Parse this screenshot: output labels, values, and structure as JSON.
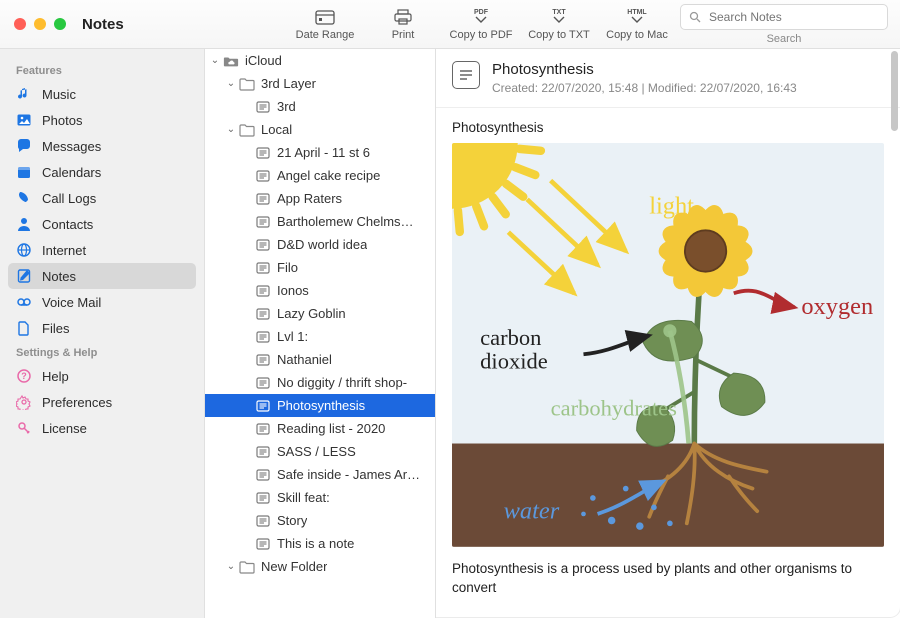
{
  "window": {
    "title": "Notes"
  },
  "toolbar": {
    "buttons": [
      {
        "id": "date-range",
        "label": "Date Range"
      },
      {
        "id": "print",
        "label": "Print"
      },
      {
        "id": "copy-pdf",
        "label": "Copy to PDF",
        "badge": "PDF"
      },
      {
        "id": "copy-txt",
        "label": "Copy to TXT",
        "badge": "TXT"
      },
      {
        "id": "copy-mac",
        "label": "Copy to Mac",
        "badge": "HTML"
      }
    ],
    "search": {
      "placeholder": "Search Notes",
      "label": "Search"
    }
  },
  "sidebar": {
    "sections": [
      {
        "label": "Features",
        "items": [
          {
            "id": "music",
            "label": "Music",
            "color": "#1e76e3",
            "icon": "music"
          },
          {
            "id": "photos",
            "label": "Photos",
            "color": "#1e76e3",
            "icon": "photo"
          },
          {
            "id": "messages",
            "label": "Messages",
            "color": "#1e76e3",
            "icon": "chat"
          },
          {
            "id": "calendars",
            "label": "Calendars",
            "color": "#1e76e3",
            "icon": "calendar"
          },
          {
            "id": "calllogs",
            "label": "Call Logs",
            "color": "#1e76e3",
            "icon": "phone"
          },
          {
            "id": "contacts",
            "label": "Contacts",
            "color": "#1e76e3",
            "icon": "person"
          },
          {
            "id": "internet",
            "label": "Internet",
            "color": "#1e76e3",
            "icon": "globe"
          },
          {
            "id": "notes",
            "label": "Notes",
            "color": "#1e76e3",
            "icon": "note",
            "selected": true
          },
          {
            "id": "voicemail",
            "label": "Voice Mail",
            "color": "#1e76e3",
            "icon": "voicemail"
          },
          {
            "id": "files",
            "label": "Files",
            "color": "#1e76e3",
            "icon": "file"
          }
        ]
      },
      {
        "label": "Settings & Help",
        "items": [
          {
            "id": "help",
            "label": "Help",
            "color": "#e96aa9",
            "icon": "help"
          },
          {
            "id": "preferences",
            "label": "Preferences",
            "color": "#e96aa9",
            "icon": "prefs"
          },
          {
            "id": "license",
            "label": "License",
            "color": "#e96aa9",
            "icon": "license"
          }
        ]
      }
    ]
  },
  "tree": {
    "nodes": [
      {
        "depth": 0,
        "type": "folder",
        "label": "iCloud",
        "open": true,
        "icon": "cloud"
      },
      {
        "depth": 1,
        "type": "folder",
        "label": "3rd Layer",
        "open": true
      },
      {
        "depth": 2,
        "type": "note",
        "label": "3rd"
      },
      {
        "depth": 1,
        "type": "folder",
        "label": "Local",
        "open": true
      },
      {
        "depth": 2,
        "type": "note",
        "label": "21 April - 11 st 6"
      },
      {
        "depth": 2,
        "type": "note",
        "label": "Angel cake recipe"
      },
      {
        "depth": 2,
        "type": "note",
        "label": "App Raters"
      },
      {
        "depth": 2,
        "type": "note",
        "label": "Bartholemew Chelms…"
      },
      {
        "depth": 2,
        "type": "note",
        "label": "D&D world idea"
      },
      {
        "depth": 2,
        "type": "note",
        "label": "Filo"
      },
      {
        "depth": 2,
        "type": "note",
        "label": "Ionos"
      },
      {
        "depth": 2,
        "type": "note",
        "label": "Lazy Goblin"
      },
      {
        "depth": 2,
        "type": "note",
        "label": "Lvl 1:"
      },
      {
        "depth": 2,
        "type": "note",
        "label": "Nathaniel"
      },
      {
        "depth": 2,
        "type": "note",
        "label": "No diggity / thrift shop-"
      },
      {
        "depth": 2,
        "type": "note",
        "label": "Photosynthesis",
        "selected": true
      },
      {
        "depth": 2,
        "type": "note",
        "label": "Reading list - 2020"
      },
      {
        "depth": 2,
        "type": "note",
        "label": "SASS / LESS"
      },
      {
        "depth": 2,
        "type": "note",
        "label": "Safe inside - James Ar…"
      },
      {
        "depth": 2,
        "type": "note",
        "label": "Skill feat:"
      },
      {
        "depth": 2,
        "type": "note",
        "label": "Story"
      },
      {
        "depth": 2,
        "type": "note",
        "label": "This is a note"
      },
      {
        "depth": 1,
        "type": "folder",
        "label": "New Folder",
        "open": true
      }
    ]
  },
  "note": {
    "title": "Photosynthesis",
    "meta": "Created: 22/07/2020, 15:48 | Modified: 22/07/2020, 16:43",
    "subtitle": "Photosynthesis",
    "diagram": {
      "labels": {
        "light": "light",
        "oxygen": "oxygen",
        "co2_line1": "carbon",
        "co2_line2": "dioxide",
        "carbs": "carbohydrates",
        "water": "water"
      },
      "colors": {
        "sky": "#eaf1f6",
        "sun": "#f4d23a",
        "light_arrow": "#f4d23a",
        "oxygen": "#b12c2f",
        "co2": "#222",
        "carbs": "#9dc489",
        "water": "#5b98dd",
        "soil": "#6b4a37",
        "stem": "#5a7a47",
        "leaf": "#6f8f54",
        "root": "#b5823f",
        "flower_petal": "#f3c838",
        "flower_center": "#7a4f2c"
      }
    },
    "body_paragraph": "Photosynthesis is a process used by plants and other organisms to convert"
  }
}
